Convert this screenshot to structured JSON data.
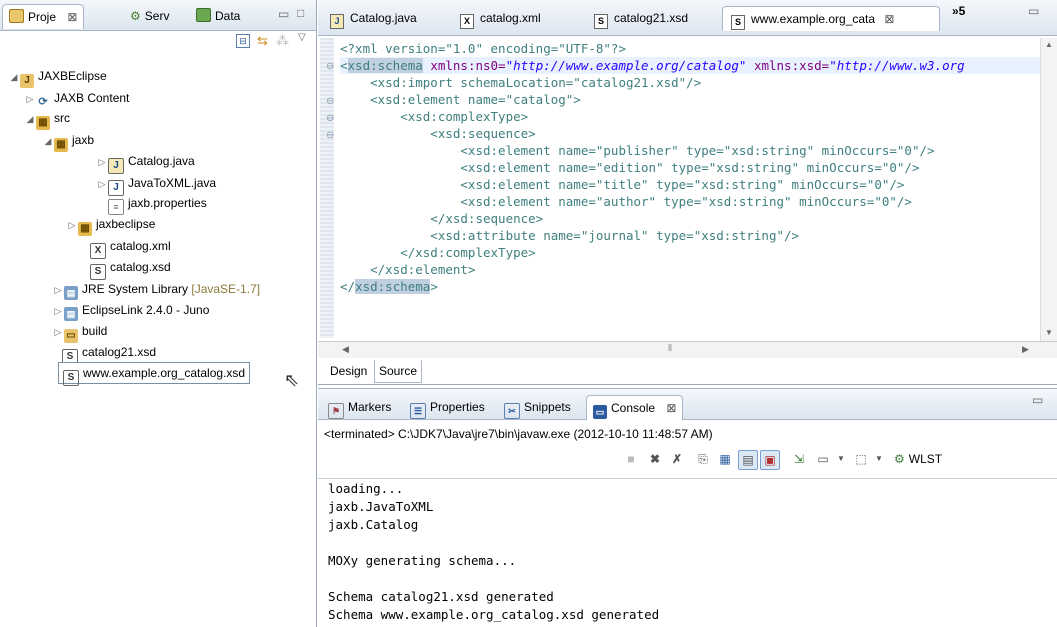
{
  "left_tabs": [
    {
      "label": "Proje",
      "close": "⊠"
    },
    {
      "label": "Serv"
    },
    {
      "label": "Data"
    }
  ],
  "tree": {
    "project": "JAXBEclipse",
    "jaxb_content": "JAXB Content",
    "src": "src",
    "jaxb_pkg": "jaxb",
    "catalog_java": "Catalog.java",
    "javatoxml_java": "JavaToXML.java",
    "jaxb_properties": "jaxb.properties",
    "jaxbeclipse_pkg": "jaxbeclipse",
    "catalog_xml": "catalog.xml",
    "catalog_xsd": "catalog.xsd",
    "jre_lib": "JRE System Library",
    "jre_ver": "[JavaSE-1.7]",
    "eclipselink": "EclipseLink 2.4.0 - Juno",
    "build": "build",
    "catalog21_xsd": "catalog21.xsd",
    "example_xsd": "www.example.org_catalog.xsd"
  },
  "editor_tabs": [
    {
      "label": "Catalog.java",
      "icon": "J"
    },
    {
      "label": "catalog.xml",
      "icon": "X"
    },
    {
      "label": "catalog21.xsd",
      "icon": "S"
    },
    {
      "label": "www.example.org_cata",
      "icon": "S"
    }
  ],
  "editor_overflow": "»5",
  "code": {
    "l1": "<?xml version=\"1.0\" encoding=\"UTF-8\"?>",
    "l2a": "<",
    "l2b": "xsd:schema",
    "l2c": " xmlns:ns0=",
    "l2d": "\"http://www.example.org/catalog\"",
    "l2e": " xmlns:xsd=",
    "l2f": "\"http://www.w3.org",
    "l3": "    <xsd:import schemaLocation=\"catalog21.xsd\"/>",
    "l4": "    <xsd:element name=\"catalog\">",
    "l5": "        <xsd:complexType>",
    "l6": "            <xsd:sequence>",
    "l7": "                <xsd:element name=\"publisher\" type=\"xsd:string\" minOccurs=\"0\"/>",
    "l8": "                <xsd:element name=\"edition\" type=\"xsd:string\" minOccurs=\"0\"/>",
    "l9": "                <xsd:element name=\"title\" type=\"xsd:string\" minOccurs=\"0\"/>",
    "l10": "                <xsd:element name=\"author\" type=\"xsd:string\" minOccurs=\"0\"/>",
    "l11": "            </xsd:sequence>",
    "l12": "            <xsd:attribute name=\"journal\" type=\"xsd:string\"/>",
    "l13": "        </xsd:complexType>",
    "l14": "    </xsd:element>",
    "l15a": "</",
    "l15b": "xsd:schema",
    "l15c": ">"
  },
  "bottom_tabs": {
    "design": "Design",
    "source": "Source"
  },
  "console_tabs": [
    {
      "label": "Markers"
    },
    {
      "label": "Properties"
    },
    {
      "label": "Snippets"
    },
    {
      "label": "Console",
      "close": "⊠"
    }
  ],
  "console_status": "<terminated> C:\\JDK7\\Java\\jre7\\bin\\javaw.exe (2012-10-10 11:48:57 AM)",
  "wlst_label": "WLST",
  "console_output": [
    "loading...",
    "jaxb.JavaToXML",
    "jaxb.Catalog",
    "",
    "MOXy generating schema...",
    "",
    "Schema catalog21.xsd generated",
    "Schema www.example.org_catalog.xsd generated"
  ]
}
